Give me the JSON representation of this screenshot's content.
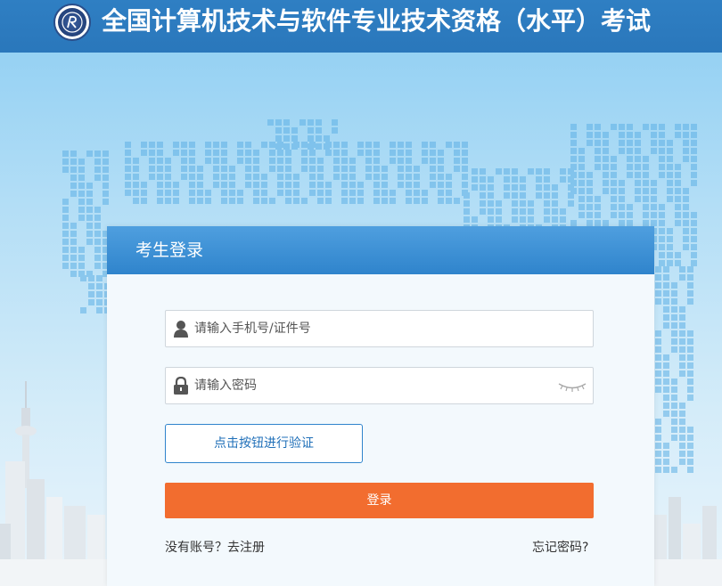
{
  "header": {
    "title": "全国计算机技术与软件专业技术资格（水平）考试"
  },
  "login": {
    "title": "考生登录",
    "username_placeholder": "请输入手机号/证件号",
    "password_placeholder": "请输入密码",
    "verify_label": "点击按钮进行验证",
    "submit_label": "登录",
    "no_account_text": "没有账号？",
    "register_label": "去注册",
    "forgot_label": "忘记密码?"
  },
  "colors": {
    "header_bg": "#2a77bb",
    "card_header_bg": "#2f84cc",
    "primary_button": "#f26d2f",
    "verify_border": "#2f84cc"
  },
  "icons": {
    "username": "user-icon",
    "password": "lock-icon",
    "toggle_password": "eye-closed-icon",
    "logo": "exam-logo"
  }
}
